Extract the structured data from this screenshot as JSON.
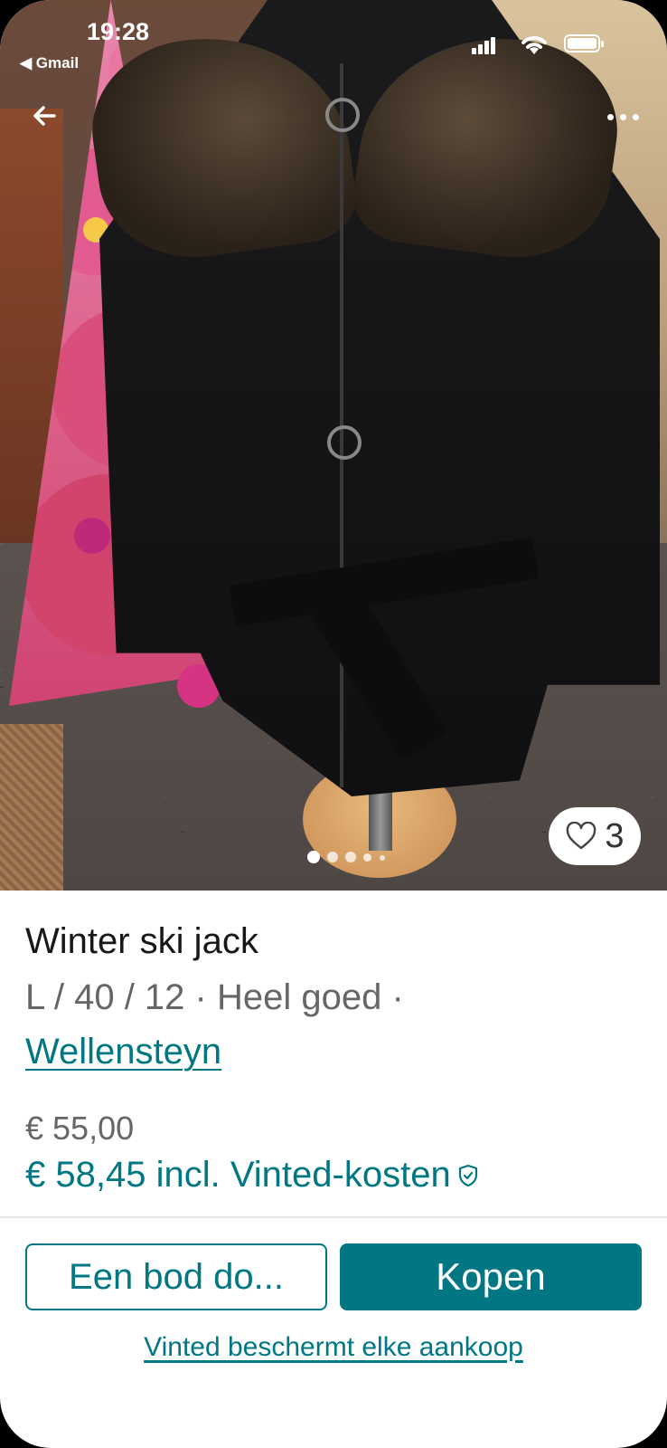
{
  "status_bar": {
    "time": "19:28",
    "back_app": "◀ Gmail"
  },
  "nav": {
    "back_icon": "arrow-left-icon",
    "more_icon": "more-dots-icon"
  },
  "gallery": {
    "photo_count": 5,
    "active_index": 0,
    "likes": "3"
  },
  "item": {
    "title": "Winter ski jack",
    "details": "L / 40 / 12 · Heel goed ·",
    "brand": "Wellensteyn",
    "price": "€ 55,00",
    "price_incl": "€ 58,45 incl. Vinted-kosten"
  },
  "actions": {
    "offer_label": "Een bod do...",
    "buy_label": "Kopen",
    "protection_link": "Vinted beschermt elke aankoop"
  },
  "colors": {
    "accent": "#007782",
    "text": "#171717",
    "muted": "#666666"
  }
}
